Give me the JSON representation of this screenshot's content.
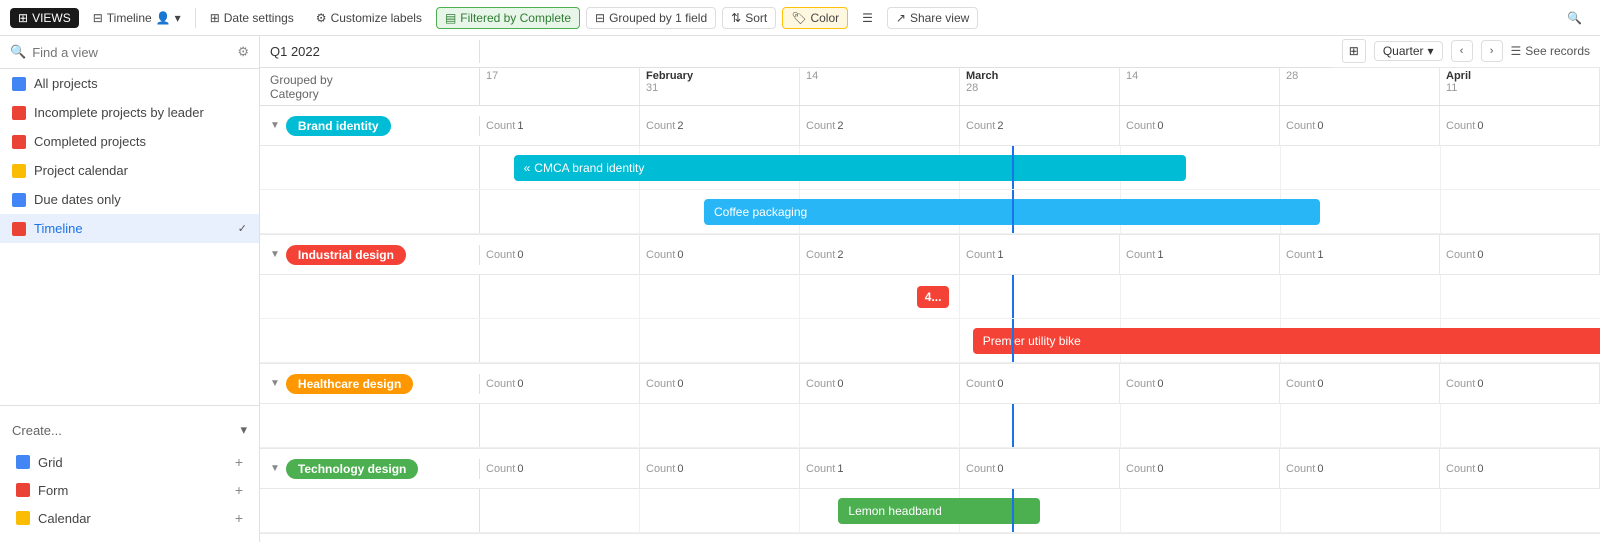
{
  "toolbar": {
    "views_label": "VIEWS",
    "timeline_label": "Timeline",
    "date_settings": "Date settings",
    "customize_labels": "Customize labels",
    "filtered_label": "Filtered by Complete",
    "grouped_label": "Grouped by 1 field",
    "sort_label": "Sort",
    "color_label": "Color",
    "density_label": "",
    "share_label": "Share view"
  },
  "sidebar": {
    "search_placeholder": "Find a view",
    "items": [
      {
        "label": "All projects",
        "icon": "grid",
        "active": false
      },
      {
        "label": "Incomplete projects by leader",
        "icon": "list",
        "active": false
      },
      {
        "label": "Completed projects",
        "icon": "list",
        "active": false
      },
      {
        "label": "Project calendar",
        "icon": "calendar",
        "active": false
      },
      {
        "label": "Due dates only",
        "icon": "grid",
        "active": false
      },
      {
        "label": "Timeline",
        "icon": "timeline",
        "active": true
      }
    ],
    "create_label": "Create...",
    "create_items": [
      {
        "label": "Grid"
      },
      {
        "label": "Form"
      },
      {
        "label": "Calendar"
      }
    ]
  },
  "timeline": {
    "grouped_by": "Grouped by\nCategory",
    "q_label": "Q1 2022",
    "quarter_selector": "Quarter",
    "see_records": "See records",
    "months": [
      {
        "date": "17",
        "name": ""
      },
      {
        "date": "31",
        "name": "February"
      },
      {
        "date": "14",
        "name": ""
      },
      {
        "date": "28",
        "name": "March"
      },
      {
        "date": "14",
        "name": ""
      },
      {
        "date": "28",
        "name": ""
      },
      {
        "date": "11",
        "name": "April"
      }
    ],
    "groups": [
      {
        "name": "Brand identity",
        "color": "cyan",
        "counts": [
          1,
          2,
          2,
          2,
          0,
          0,
          0
        ],
        "bars": [
          {
            "label": "CMCA brand identity",
            "color": "cyan",
            "left_pct": 5,
            "width_pct": 56,
            "row": 0
          },
          {
            "label": "Coffee packaging",
            "color": "cyan2",
            "left_pct": 22,
            "width_pct": 53,
            "row": 1
          }
        ]
      },
      {
        "name": "Industrial design",
        "color": "red",
        "counts": [
          0,
          0,
          2,
          1,
          1,
          1,
          0
        ],
        "overlap_label": "4...",
        "bars": [
          {
            "label": "Premier utility bike",
            "color": "red",
            "left_pct": 47,
            "width_pct": 60,
            "row": 1
          }
        ]
      },
      {
        "name": "Healthcare design",
        "color": "orange",
        "counts": [
          0,
          0,
          0,
          0,
          0,
          0,
          0
        ],
        "bars": []
      },
      {
        "name": "Technology design",
        "color": "green",
        "counts": [
          0,
          0,
          1,
          0,
          0,
          0,
          0
        ],
        "bars": [
          {
            "label": "Lemon headband",
            "color": "green",
            "left_pct": 37,
            "width_pct": 20,
            "row": 0
          }
        ]
      }
    ]
  }
}
